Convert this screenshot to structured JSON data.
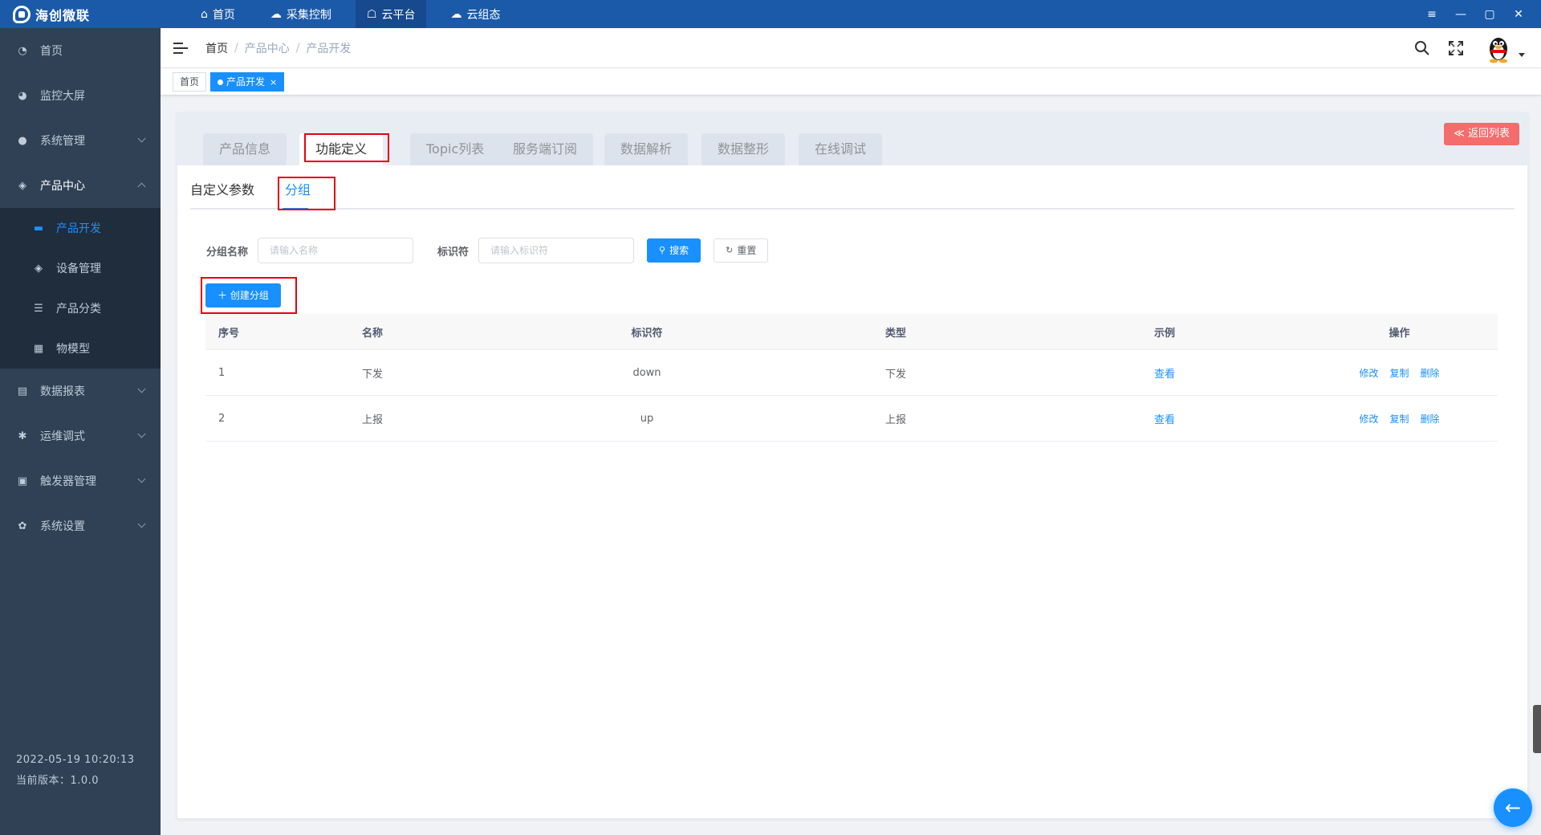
{
  "app": {
    "logo_text": "海创微联"
  },
  "topnav": [
    {
      "label": "首页",
      "icon": "home-icon",
      "glyph": "⌂"
    },
    {
      "label": "采集控制",
      "icon": "cloud-sync-icon",
      "glyph": "☁"
    },
    {
      "label": "云平台",
      "icon": "cloud-platform-icon",
      "glyph": "☖"
    },
    {
      "label": "云组态",
      "icon": "cloud-config-icon",
      "glyph": "☁"
    }
  ],
  "window_controls": {
    "menu": "≡",
    "minimize": "—",
    "maximize": "▢",
    "close": "✕"
  },
  "sidebar": {
    "items": [
      {
        "label": "首页",
        "glyph": "◔"
      },
      {
        "label": "监控大屏",
        "glyph": "◕"
      },
      {
        "label": "系统管理",
        "glyph": "●"
      },
      {
        "label": "产品中心",
        "glyph": "◈"
      }
    ],
    "subitems": [
      {
        "label": "产品开发",
        "glyph": "▬"
      },
      {
        "label": "设备管理",
        "glyph": "◈"
      },
      {
        "label": "产品分类",
        "glyph": "☰"
      },
      {
        "label": "物模型",
        "glyph": "▦"
      }
    ],
    "items_after": [
      {
        "label": "数据报表",
        "glyph": "▤"
      },
      {
        "label": "运维调式",
        "glyph": "✱"
      },
      {
        "label": "触发器管理",
        "glyph": "▣"
      },
      {
        "label": "系统设置",
        "glyph": "✿"
      }
    ],
    "datetime": "2022-05-19 10:20:13",
    "version": "当前版本：1.0.0"
  },
  "header": {
    "breadcrumb": [
      "首页",
      "产品中心",
      "产品开发"
    ],
    "breadcrumb_sep": "/"
  },
  "tags": [
    {
      "label": "首页"
    },
    {
      "label": "产品开发",
      "close": "×"
    }
  ],
  "product_tabs": [
    "产品信息",
    "功能定义",
    "Topic列表",
    "服务端订阅",
    "数据解析",
    "数据整形",
    "在线调试"
  ],
  "back_button": "≪ 返回列表",
  "sub_tabs": [
    "自定义参数",
    "分组"
  ],
  "search_form": {
    "group_name_label": "分组名称",
    "group_name_placeholder": "请输入名称",
    "identifier_label": "标识符",
    "identifier_placeholder": "请输入标识符",
    "search_button": "搜索",
    "reset_button": "重置"
  },
  "create_button": "＋ 创建分组",
  "table": {
    "headers": [
      "序号",
      "名称",
      "标识符",
      "类型",
      "示例",
      "操作"
    ],
    "rows": [
      {
        "index": "1",
        "name": "下发",
        "identifier": "down",
        "type": "下发",
        "example": "查看",
        "ops": [
          "修改",
          "复制",
          "删除"
        ]
      },
      {
        "index": "2",
        "name": "上报",
        "identifier": "up",
        "type": "上报",
        "example": "查看",
        "ops": [
          "修改",
          "复制",
          "删除"
        ]
      }
    ]
  },
  "colors": {
    "topbar": "#1b5aa8",
    "sidebar": "#304156",
    "primary": "#1890ff",
    "danger": "#f56c6c",
    "highlight_box": "#e60012"
  }
}
